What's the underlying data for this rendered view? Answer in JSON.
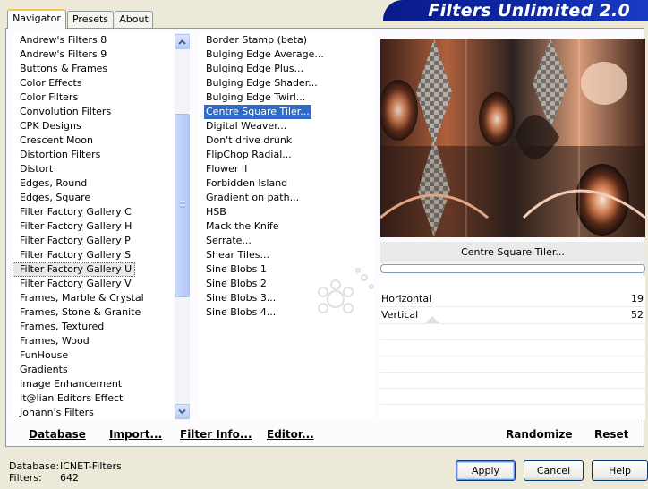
{
  "tabs": [
    {
      "label": "Navigator"
    },
    {
      "label": "Presets"
    },
    {
      "label": "About"
    }
  ],
  "banner": {
    "title": "Filters Unlimited 2.0"
  },
  "categories": [
    "Andrew's Filters 8",
    "Andrew's Filters 9",
    "Buttons & Frames",
    "Color Effects",
    "Color Filters",
    "Convolution Filters",
    "CPK Designs",
    "Crescent Moon",
    "Distortion Filters",
    "Distort",
    "Edges, Round",
    "Edges, Square",
    "Filter Factory Gallery C",
    "Filter Factory Gallery H",
    "Filter Factory Gallery P",
    "Filter Factory Gallery S",
    "Filter Factory Gallery U",
    "Filter Factory Gallery V",
    "Frames, Marble & Crystal",
    "Frames, Stone & Granite",
    "Frames, Textured",
    "Frames, Wood",
    "FunHouse",
    "Gradients",
    "Image Enhancement",
    "It@lian Editors Effect",
    "Johann's Filters"
  ],
  "selected_category": "Filter Factory Gallery U",
  "filters": [
    "Border Stamp (beta)",
    "Bulging Edge Average...",
    "Bulging Edge Plus...",
    "Bulging Edge Shader...",
    "Bulging Edge Twirl...",
    "Centre Square Tiler...",
    "Digital Weaver...",
    "Don't drive drunk",
    "FlipChop Radial...",
    "Flower II",
    "Forbidden Island",
    "Gradient on path...",
    "HSB",
    "Mack the Knife",
    "Serrate...",
    "Shear Tiles...",
    "Sine Blobs 1",
    "Sine Blobs 2",
    "Sine Blobs 3...",
    "Sine Blobs 4..."
  ],
  "selected_filter": "Centre Square Tiler...",
  "preview_title": "Centre Square Tiler...",
  "progress": 0,
  "parameters": [
    {
      "label": "Horizontal",
      "value": "19"
    },
    {
      "label": "Vertical",
      "value": "52"
    }
  ],
  "toolbar": {
    "database": "Database",
    "import": "Import...",
    "filter_info": "Filter Info...",
    "editor": "Editor...",
    "randomize": "Randomize",
    "reset": "Reset"
  },
  "status": {
    "database_label": "Database:",
    "database_value": "ICNET-Filters",
    "filters_label": "Filters:",
    "filters_value": "642"
  },
  "buttons": {
    "apply": "Apply",
    "cancel": "Cancel",
    "help": "Help"
  },
  "colors": {
    "banner": "#0d2aa8",
    "selection": "#316ac5",
    "tab_highlight": "#f3c54c"
  }
}
